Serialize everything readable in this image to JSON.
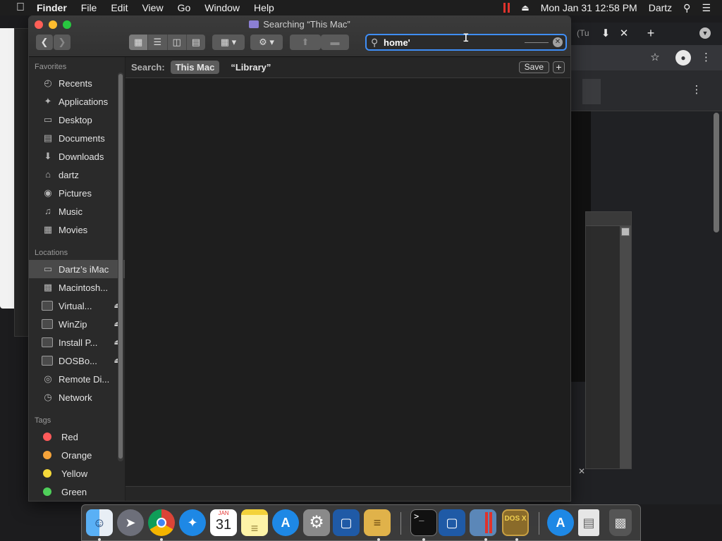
{
  "menubar": {
    "app_name": "Finder",
    "menus": [
      "File",
      "Edit",
      "View",
      "Go",
      "Window",
      "Help"
    ],
    "datetime": "Mon Jan 31  12:58 PM",
    "user": "Dartz"
  },
  "window": {
    "title": "Searching “This Mac”"
  },
  "search": {
    "query": "home'",
    "label": "Search:",
    "scope_active": "This Mac",
    "scope_other": "“Library”",
    "save_label": "Save",
    "add_label": "+"
  },
  "sidebar": {
    "favorites_header": "Favorites",
    "favorites": [
      {
        "label": "Recents",
        "icon": "clock-icon"
      },
      {
        "label": "Applications",
        "icon": "applications-icon"
      },
      {
        "label": "Desktop",
        "icon": "desktop-icon"
      },
      {
        "label": "Documents",
        "icon": "documents-icon"
      },
      {
        "label": "Downloads",
        "icon": "downloads-icon"
      },
      {
        "label": "dartz",
        "icon": "home-icon"
      },
      {
        "label": "Pictures",
        "icon": "camera-icon"
      },
      {
        "label": "Music",
        "icon": "music-note-icon"
      },
      {
        "label": "Movies",
        "icon": "film-icon"
      }
    ],
    "locations_header": "Locations",
    "locations": [
      {
        "label": "Dartz’s iMac",
        "icon": "imac-icon"
      },
      {
        "label": "Macintosh...",
        "icon": "hard-disk-icon"
      },
      {
        "label": "Virtual...",
        "icon": "disk-icon"
      },
      {
        "label": "WinZip",
        "icon": "disk-icon"
      },
      {
        "label": "Install P...",
        "icon": "disk-icon"
      },
      {
        "label": "DOSBo...",
        "icon": "disk-icon"
      },
      {
        "label": "Remote Di...",
        "icon": "optical-disc-icon"
      },
      {
        "label": "Network",
        "icon": "globe-icon"
      }
    ],
    "tags_header": "Tags",
    "tags": [
      {
        "label": "Red",
        "color": "#ff5a5a"
      },
      {
        "label": "Orange",
        "color": "#f5a33a"
      },
      {
        "label": "Yellow",
        "color": "#f5d93a"
      },
      {
        "label": "Green",
        "color": "#4fcf5a"
      }
    ]
  },
  "dock": {
    "calendar_month": "JAN",
    "calendar_day": "31",
    "dosbox_label": "DOS X",
    "terminal_prompt": ">_",
    "apps": [
      {
        "name": "finder-icon"
      },
      {
        "name": "launchpad-icon"
      },
      {
        "name": "chrome-icon"
      },
      {
        "name": "safari-icon"
      },
      {
        "name": "calendar-icon"
      },
      {
        "name": "notes-icon"
      },
      {
        "name": "app-store-icon"
      },
      {
        "name": "system-preferences-icon"
      },
      {
        "name": "virtualbox-icon"
      },
      {
        "name": "archive-utility-icon"
      },
      {
        "name": "terminal-icon"
      },
      {
        "name": "virtualbox-icon"
      },
      {
        "name": "remote-desktop-icon"
      },
      {
        "name": "dosbox-icon"
      },
      {
        "name": "app-store-icon"
      },
      {
        "name": "document-icon"
      },
      {
        "name": "trash-icon"
      }
    ]
  },
  "browser": {
    "tab_fragment": "(Tu"
  },
  "colors": {
    "accent": "#3f8ef7",
    "close": "#fe5f57",
    "minimize": "#febc2e",
    "zoom": "#28c840"
  }
}
